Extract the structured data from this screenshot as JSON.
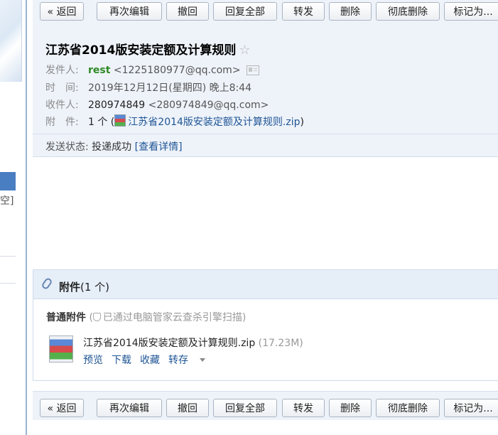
{
  "toolbar": {
    "back_label": "« 返回",
    "reedit_label": "再次编辑",
    "recall_label": "撤回",
    "reply_all_label": "回复全部",
    "forward_label": "转发",
    "delete_label": "删除",
    "perm_delete_label": "彻底删除",
    "mark_as_label": "标记为..."
  },
  "sidebar": {
    "fragment_text": "空]"
  },
  "mail": {
    "subject": "江苏省2014版安装定额及计算规则",
    "star_glyph": "☆",
    "from_label": "发件人:",
    "from_name": "rest",
    "from_email": "<1225180977@qq.com>",
    "time_label": "时　间:",
    "time_value": "2019年12月12日(星期四) 晚上8:44",
    "to_label": "收件人:",
    "to_name": "280974849",
    "to_email": "<280974849@qq.com>",
    "attach_label": "附　件:",
    "attach_count": "1 个 (",
    "attach_file": "江苏省2014版安装定额及计算规则.zip",
    "attach_close": ")",
    "status_label": "发送状态:",
    "status_value": "投递成功",
    "status_detail": "[查看详情]"
  },
  "attachments": {
    "title": "附件",
    "count": "(1 个)",
    "section_label": "普通附件",
    "scan_open": "(",
    "scan_text": "已通过电脑管家云查杀引擎扫描",
    "scan_close": ")",
    "file_name": "江苏省2014版安装定额及计算规则.zip",
    "file_size": "(17.23M)",
    "preview_label": "预览",
    "download_label": "下载",
    "favorite_label": "收藏",
    "save_label": "转存"
  },
  "icons": {
    "contact": "contact-card-icon",
    "zip": "zip-archive-icon",
    "clip": "paperclip-icon",
    "shield": "shield-icon",
    "star": "star-icon",
    "caret": "caret-down-icon"
  },
  "colors": {
    "header_bg": "#eef3fa",
    "sender_green": "#2e8a23",
    "link_blue": "#1e5494",
    "sidebar_selected": "#4a7ec3"
  }
}
